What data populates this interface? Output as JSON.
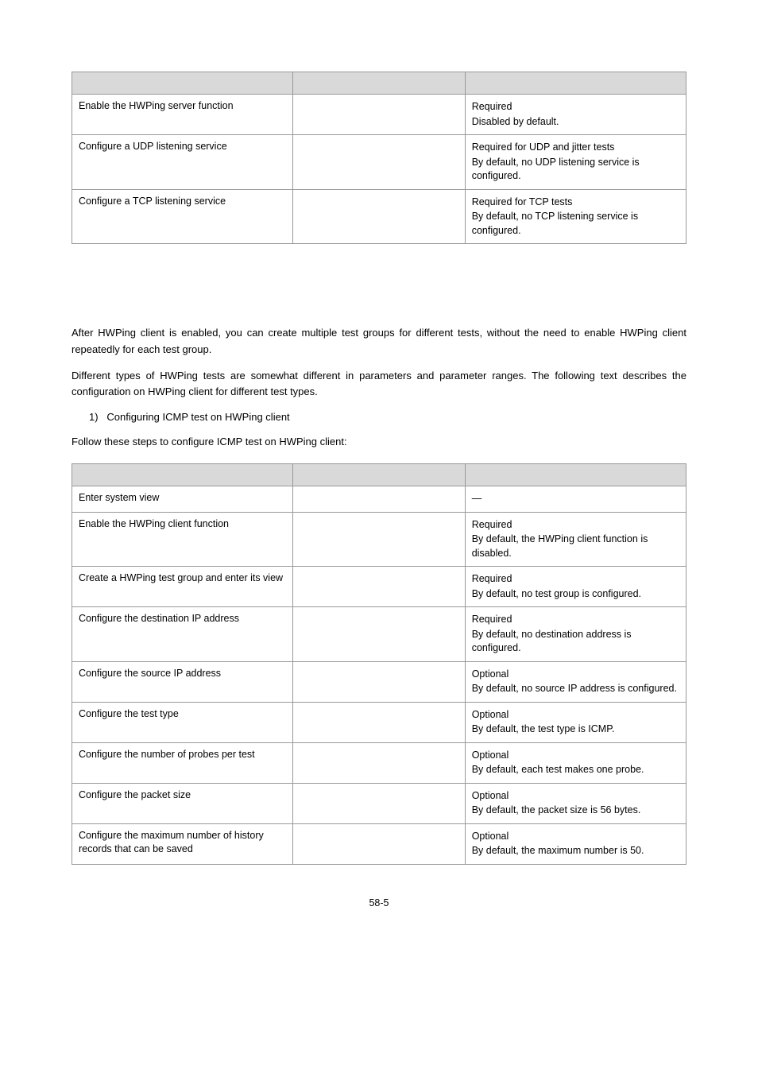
{
  "table1": {
    "rows": [
      {
        "label": "Enable the HWPing server function",
        "desc": [
          "Required",
          "Disabled by default."
        ]
      },
      {
        "label": "Configure a UDP listening service",
        "desc": [
          "Required for UDP and jitter tests",
          "By default, no UDP listening service is configured."
        ]
      },
      {
        "label": "Configure a TCP listening service",
        "desc": [
          "Required for TCP tests",
          "By default, no TCP listening service is configured."
        ]
      }
    ]
  },
  "para1": "After HWPing client is enabled, you can create multiple test groups for different tests, without the need to enable HWPing client repeatedly for each test group.",
  "para2": "Different types of HWPing tests are somewhat different in parameters and parameter ranges. The following text describes the configuration on HWPing client for different test types.",
  "listitem1_num": "1)",
  "listitem1_text": "Configuring ICMP test on HWPing client",
  "para3": "Follow these steps to configure ICMP test on HWPing client:",
  "table2": {
    "rows": [
      {
        "label": "Enter system view",
        "desc": [
          "—"
        ]
      },
      {
        "label": "Enable the HWPing client function",
        "desc": [
          "Required",
          "By default, the HWPing client function is disabled."
        ]
      },
      {
        "label": "Create a HWPing test group and enter its view",
        "desc": [
          "Required",
          "By default, no test group is configured."
        ]
      },
      {
        "label": "Configure the destination IP address",
        "desc": [
          "Required",
          "By default, no destination address is configured."
        ]
      },
      {
        "label": "Configure the source IP address",
        "desc": [
          "Optional",
          "By default, no source IP address is configured."
        ]
      },
      {
        "label": "Configure the test type",
        "desc": [
          "Optional",
          "By default, the test type is ICMP."
        ]
      },
      {
        "label": "Configure the number of probes per test",
        "desc": [
          "Optional",
          "By default, each test makes one probe."
        ]
      },
      {
        "label": "Configure the packet size",
        "desc": [
          "Optional",
          "By default, the packet size is 56 bytes."
        ]
      },
      {
        "label": "Configure the maximum number of history records that can be saved",
        "desc": [
          "Optional",
          "By default, the maximum number is 50."
        ]
      }
    ]
  },
  "page_number": "58-5"
}
